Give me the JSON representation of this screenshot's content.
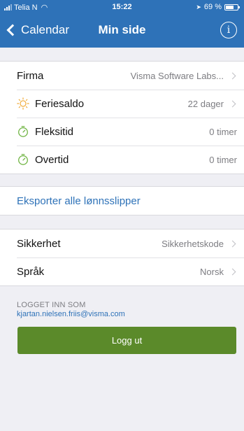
{
  "status": {
    "carrier": "Telia N",
    "time": "15:22",
    "battery": "69 %",
    "battery_level": 0.69
  },
  "nav": {
    "back_label": "Calendar",
    "title": "Min side",
    "info_icon": "info-icon"
  },
  "rows": {
    "firma": {
      "label": "Firma",
      "value": "Visma Software Labs..."
    },
    "feriesaldo": {
      "label": "Feriesaldo",
      "value": "22 dager",
      "icon": "sun-icon"
    },
    "fleksitid": {
      "label": "Fleksitid",
      "value": "0 timer",
      "icon": "stopwatch-icon"
    },
    "overtid": {
      "label": "Overtid",
      "value": "0 timer",
      "icon": "stopwatch-icon"
    },
    "export": {
      "label": "Eksporter alle lønnsslipper"
    },
    "sikkerhet": {
      "label": "Sikkerhet",
      "value": "Sikkerhetskode"
    },
    "sprak": {
      "label": "Språk",
      "value": "Norsk"
    }
  },
  "account": {
    "caption": "LOGGET INN SOM",
    "email": "kjartan.nielsen.friis@visma.com",
    "logout_label": "Logg ut"
  },
  "colors": {
    "brand": "#2e72b8",
    "logout": "#5b8a2a",
    "sun": "#f0a830",
    "stopwatch": "#6db33f"
  }
}
